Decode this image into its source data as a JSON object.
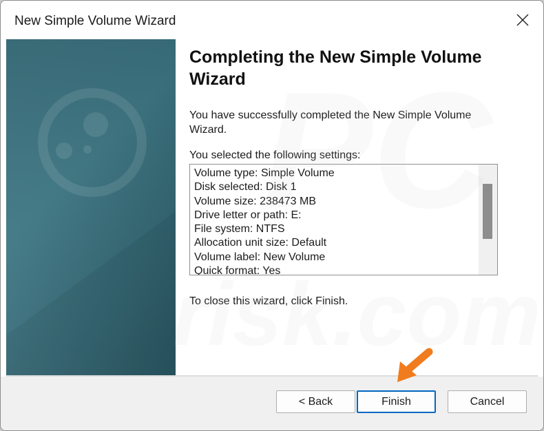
{
  "window": {
    "title": "New Simple Volume Wizard"
  },
  "heading": "Completing the New Simple Volume Wizard",
  "success_text": "You have successfully completed the New Simple Volume Wizard.",
  "settings_label": "You selected the following settings:",
  "settings": [
    "Volume type: Simple Volume",
    "Disk selected: Disk 1",
    "Volume size: 238473 MB",
    "Drive letter or path: E:",
    "File system: NTFS",
    "Allocation unit size: Default",
    "Volume label: New Volume",
    "Quick format: Yes"
  ],
  "close_text": "To close this wizard, click Finish.",
  "buttons": {
    "back": "< Back",
    "finish": "Finish",
    "cancel": "Cancel"
  },
  "watermark_text": "PC risk.com",
  "colors": {
    "banner": "#3a717e",
    "primary_border": "#0067c0",
    "arrow": "#f07c1e"
  },
  "icons": {
    "close": "close-icon",
    "arrow": "arrow-pointer-icon"
  }
}
